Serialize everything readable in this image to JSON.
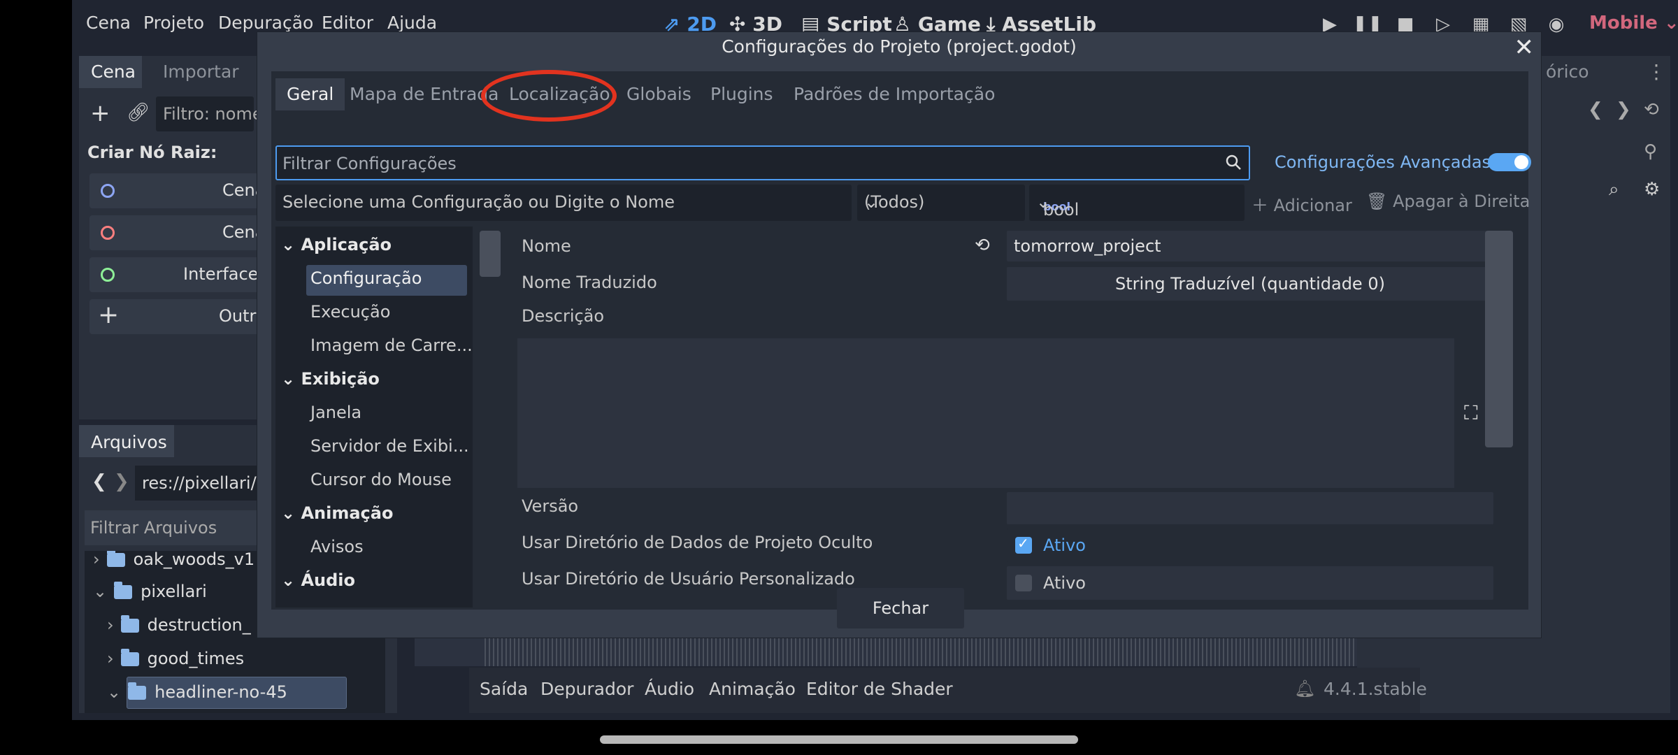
{
  "menu": [
    "Cena",
    "Projeto",
    "Depuração",
    "Editor",
    "Ajuda"
  ],
  "workspaces": [
    "2D",
    "3D",
    "Script",
    "Game",
    "AssetLib"
  ],
  "renderer": "Mobile",
  "scene_dock": {
    "tabs": [
      "Cena",
      "Importar"
    ],
    "filter_placeholder": "Filtro: nome",
    "create_root": "Criar Nó Raiz:",
    "root_buttons": [
      "Cena",
      "Cena",
      "Interface de",
      "Outro"
    ]
  },
  "right_dock": {
    "tab": "órico"
  },
  "filesystem": {
    "tab": "Arquivos",
    "path": "res://pixellari/h",
    "filter": "Filtrar Arquivos",
    "items": [
      "oak_woods_v1",
      "pixellari",
      "destruction_",
      "good_times",
      "headliner-no-45"
    ]
  },
  "bottom_panel": {
    "tabs": [
      "Saída",
      "Depurador",
      "Áudio",
      "Animação",
      "Editor de Shader"
    ],
    "version": "4.4.1.stable"
  },
  "dialog": {
    "title": "Configurações do Projeto (project.godot)",
    "tabs": [
      "Geral",
      "Mapa de Entrada",
      "Localização",
      "Globais",
      "Plugins",
      "Padrões de Importação"
    ],
    "filter_placeholder": "Filtrar Configurações",
    "advanced": "Configurações Avançadas",
    "select_placeholder": "Selecione uma Configuração ou Digite o Nome",
    "type_filter": "(Todos)",
    "type_value": "bool",
    "add": "Adicionar",
    "delete": "Apagar à Direita",
    "tree": {
      "s1": "Aplicação",
      "s1_items": [
        "Configuração",
        "Execução",
        "Imagem de Carre..."
      ],
      "s2": "Exibição",
      "s2_items": [
        "Janela",
        "Servidor de Exibi...",
        "Cursor do Mouse"
      ],
      "s3": "Animação",
      "s3_items": [
        "Avisos"
      ],
      "s4": "Áudio"
    },
    "props": {
      "name_label": "Nome",
      "name_value": "tomorrow_project",
      "tname_label": "Nome Traduzido",
      "tname_value": "String Traduzível (quantidade 0)",
      "desc_label": "Descrição",
      "version_label": "Versão",
      "hidden_label": "Usar Diretório de Dados de Projeto Oculto",
      "hidden_value": "Ativo",
      "custom_label": "Usar Diretório de Usuário Personalizado",
      "custom_value": "Ativo"
    },
    "close": "Fechar"
  },
  "colors": {
    "accent": "#4d9bf0",
    "highlight": "#e2331f",
    "renderer": "#d2677d"
  }
}
